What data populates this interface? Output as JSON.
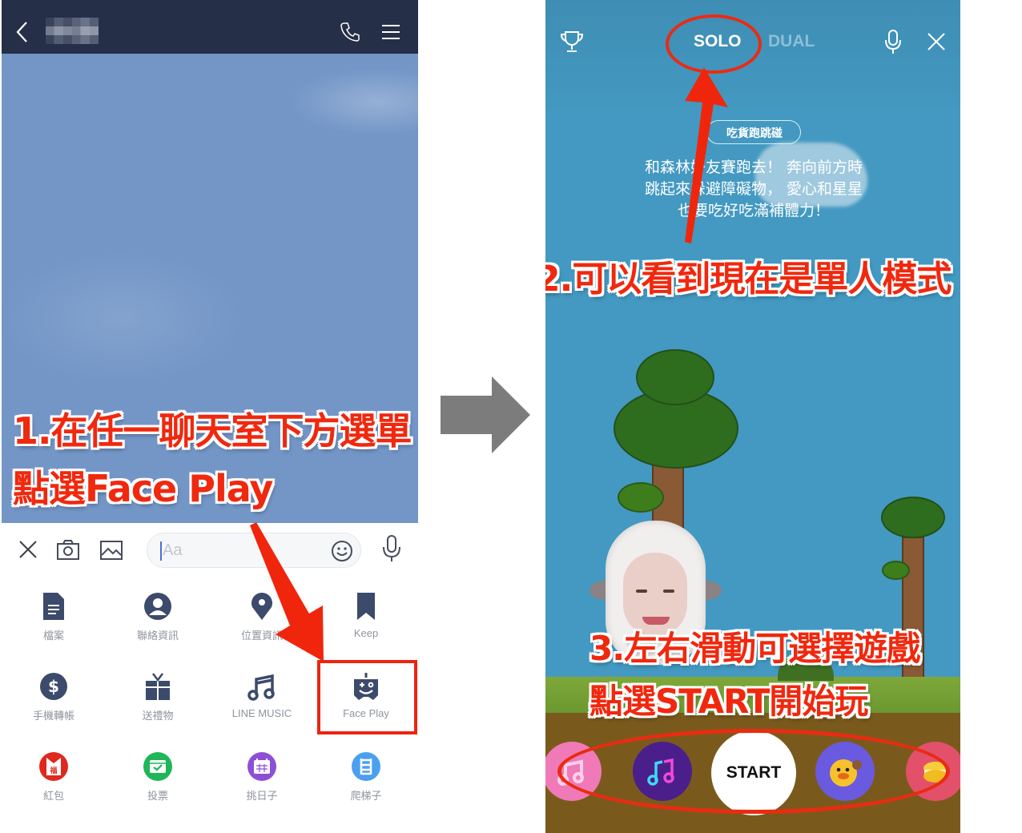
{
  "left_screen": {
    "header": {
      "contact_name": "(blurred)",
      "back_icon": "chevron-left-icon",
      "call_icon": "phone-icon",
      "menu_icon": "hamburger-menu-icon"
    },
    "input_bar": {
      "close_icon": "close-icon",
      "camera_icon": "camera-icon",
      "image_icon": "image-icon",
      "placeholder": "Aa",
      "emoji_icon": "smiley-icon",
      "mic_icon": "microphone-icon"
    },
    "menu_items": [
      {
        "label": "檔案",
        "icon": "file-icon",
        "color": "#3c4a6b"
      },
      {
        "label": "聯絡資訊",
        "icon": "contact-icon",
        "color": "#3c4a6b"
      },
      {
        "label": "位置資訊",
        "icon": "location-pin-icon",
        "color": "#3c4a6b"
      },
      {
        "label": "Keep",
        "icon": "bookmark-icon",
        "color": "#3c4a6b"
      },
      {
        "label": "手機轉帳",
        "icon": "dollar-icon",
        "color": "#3c4a6b"
      },
      {
        "label": "送禮物",
        "icon": "gift-icon",
        "color": "#3c4a6b"
      },
      {
        "label": "LINE MUSIC",
        "icon": "music-note-icon",
        "color": "#3c4a6b"
      },
      {
        "label": "Face Play",
        "icon": "face-play-icon",
        "color": "#3c4a6b"
      },
      {
        "label": "紅包",
        "icon": "red-envelope-icon",
        "color": "#e0281e"
      },
      {
        "label": "投票",
        "icon": "vote-icon",
        "color": "#1fb659"
      },
      {
        "label": "挑日子",
        "icon": "calendar-icon",
        "color": "#8d4fd6"
      },
      {
        "label": "爬梯子",
        "icon": "ladder-icon",
        "color": "#4a9ff0"
      }
    ],
    "callout_line1": "1.在任一聊天室下方選單",
    "callout_line2": "點選Face Play"
  },
  "right_screen": {
    "trophy_icon": "trophy-icon",
    "modes": {
      "solo": "SOLO",
      "dual": "DUAL",
      "active": "SOLO"
    },
    "mic_icon": "microphone-icon",
    "close_icon": "close-icon",
    "game_title": "吃貨跑跳碰",
    "game_description": [
      "和森林好友賽跑去！ 奔向前方時",
      "跳起來躲避障礙物， 愛心和星星",
      "也要吃好吃滿補體力！"
    ],
    "callout_2": "2.可以看到現在是單人模式",
    "callout_3_line1": "3.左右滑動可選擇遊戲",
    "callout_3_line2": "點選START開始玩",
    "start_label": "START",
    "games": [
      {
        "name": "pink-music-game",
        "color": "#f07ab8"
      },
      {
        "name": "neon-music-game",
        "color": "#4a1f8c"
      },
      {
        "name": "sally-game",
        "color": "#6a5ae0"
      },
      {
        "name": "macaron-game",
        "color": "#e2506a"
      }
    ]
  },
  "colors": {
    "annotation_red": "#ea2b12",
    "header_bg": "#252f47",
    "chat_bg": "#7396c7",
    "game_sky": "#4399c1"
  }
}
